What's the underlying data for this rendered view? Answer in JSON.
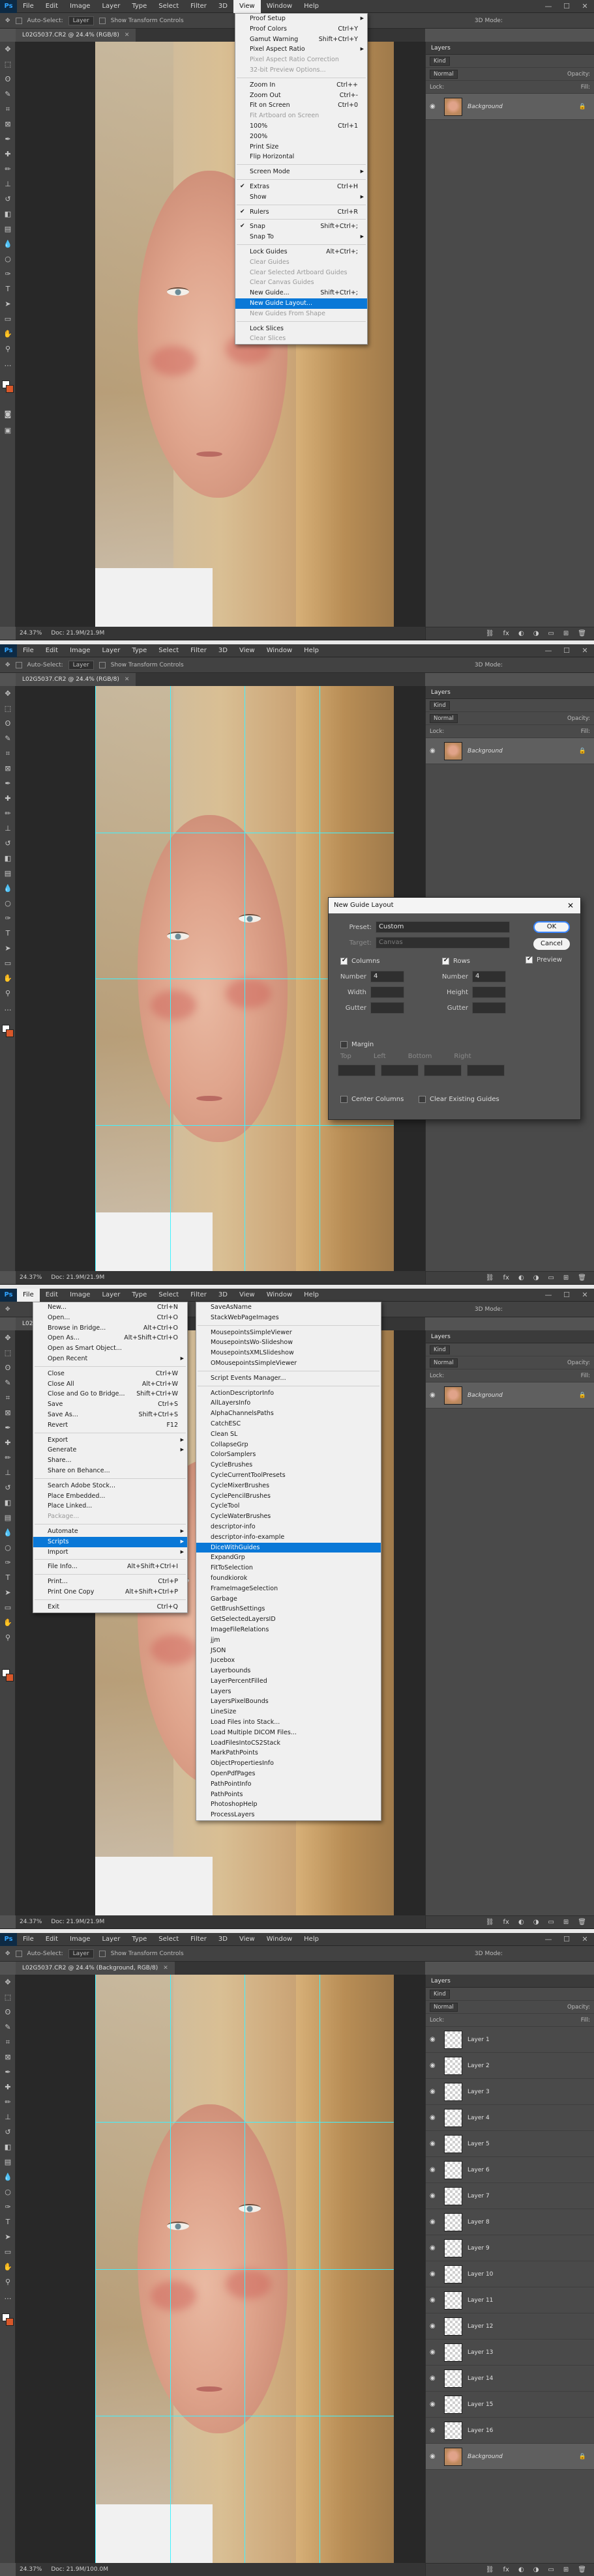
{
  "menubar": {
    "items": [
      "File",
      "Edit",
      "Image",
      "Layer",
      "Type",
      "Select",
      "Filter",
      "3D",
      "View",
      "Window",
      "Help"
    ],
    "logo": "Ps"
  },
  "options": {
    "auto_select": "Auto-Select:",
    "layer": "Layer",
    "show_transform": "Show Transform Controls",
    "mode_3d": "3D Mode:"
  },
  "document": {
    "tab_title_rgb": "L02G5037.CR2 @ 24.4% (RGB/8)",
    "tab_title_bg": "L02G5037.CR2 @ 24.4% (Background, RGB/8)",
    "zoom": "24.37%",
    "doc_size": "Doc: 21.9M/21.9M",
    "doc_size_4": "Doc: 21.9M/100.0M"
  },
  "layers": {
    "tab": "Layers",
    "kind": "Kind",
    "mode": "Normal",
    "opacity": "Opacity:",
    "lock": "Lock:",
    "fill": "Fill:",
    "background": "Background",
    "numbered": [
      "Layer 1",
      "Layer 2",
      "Layer 3",
      "Layer 4",
      "Layer 5",
      "Layer 6",
      "Layer 7",
      "Layer 8",
      "Layer 9",
      "Layer 10",
      "Layer 11",
      "Layer 12",
      "Layer 13",
      "Layer 14",
      "Layer 15",
      "Layer 16"
    ]
  },
  "view_menu": [
    {
      "label": "Proof Setup",
      "sub": true
    },
    {
      "label": "Proof Colors",
      "sc": "Ctrl+Y"
    },
    {
      "label": "Gamut Warning",
      "sc": "Shift+Ctrl+Y"
    },
    {
      "label": "Pixel Aspect Ratio",
      "sub": true
    },
    {
      "label": "Pixel Aspect Ratio Correction",
      "dis": true
    },
    {
      "label": "32-bit Preview Options...",
      "dis": true
    },
    {
      "sep": true
    },
    {
      "label": "Zoom In",
      "sc": "Ctrl++"
    },
    {
      "label": "Zoom Out",
      "sc": "Ctrl+-"
    },
    {
      "label": "Fit on Screen",
      "sc": "Ctrl+0"
    },
    {
      "label": "Fit Artboard on Screen",
      "dis": true
    },
    {
      "label": "100%",
      "sc": "Ctrl+1"
    },
    {
      "label": "200%"
    },
    {
      "label": "Print Size"
    },
    {
      "label": "Flip Horizontal"
    },
    {
      "sep": true
    },
    {
      "label": "Screen Mode",
      "sub": true
    },
    {
      "sep": true
    },
    {
      "label": "Extras",
      "sc": "Ctrl+H",
      "chk": true
    },
    {
      "label": "Show",
      "sub": true
    },
    {
      "sep": true
    },
    {
      "label": "Rulers",
      "sc": "Ctrl+R",
      "chk": true
    },
    {
      "sep": true
    },
    {
      "label": "Snap",
      "sc": "Shift+Ctrl+;",
      "chk": true
    },
    {
      "label": "Snap To",
      "sub": true
    },
    {
      "sep": true
    },
    {
      "label": "Lock Guides",
      "sc": "Alt+Ctrl+;"
    },
    {
      "label": "Clear Guides",
      "dis": true
    },
    {
      "label": "Clear Selected Artboard Guides",
      "dis": true
    },
    {
      "label": "Clear Canvas Guides",
      "dis": true
    },
    {
      "label": "New Guide...",
      "sc": "Shift+Ctrl+;"
    },
    {
      "label": "New Guide Layout...",
      "hl": true
    },
    {
      "label": "New Guides From Shape",
      "dis": true
    },
    {
      "sep": true
    },
    {
      "label": "Lock Slices"
    },
    {
      "label": "Clear Slices",
      "dis": true
    }
  ],
  "dialog": {
    "title": "New Guide Layout",
    "preset_label": "Preset:",
    "preset_value": "Custom",
    "target_label": "Target:",
    "target_value": "Canvas",
    "columns": "Columns",
    "rows": "Rows",
    "number": "Number",
    "number_cols": "4",
    "number_rows": "4",
    "width": "Width",
    "height": "Height",
    "gutter": "Gutter",
    "margin": "Margin",
    "top": "Top",
    "left": "Left",
    "bottom": "Bottom",
    "right": "Right",
    "center_columns": "Center Columns",
    "clear_existing": "Clear Existing Guides",
    "ok": "OK",
    "cancel": "Cancel",
    "preview": "Preview"
  },
  "file_menu": [
    {
      "label": "New...",
      "sc": "Ctrl+N"
    },
    {
      "label": "Open...",
      "sc": "Ctrl+O"
    },
    {
      "label": "Browse in Bridge...",
      "sc": "Alt+Ctrl+O"
    },
    {
      "label": "Open As...",
      "sc": "Alt+Shift+Ctrl+O"
    },
    {
      "label": "Open as Smart Object..."
    },
    {
      "label": "Open Recent",
      "sub": true
    },
    {
      "sep": true
    },
    {
      "label": "Close",
      "sc": "Ctrl+W"
    },
    {
      "label": "Close All",
      "sc": "Alt+Ctrl+W"
    },
    {
      "label": "Close and Go to Bridge...",
      "sc": "Shift+Ctrl+W"
    },
    {
      "label": "Save",
      "sc": "Ctrl+S"
    },
    {
      "label": "Save As...",
      "sc": "Shift+Ctrl+S"
    },
    {
      "label": "Revert",
      "sc": "F12"
    },
    {
      "sep": true
    },
    {
      "label": "Export",
      "sub": true
    },
    {
      "label": "Generate",
      "sub": true
    },
    {
      "label": "Share..."
    },
    {
      "label": "Share on Behance..."
    },
    {
      "sep": true
    },
    {
      "label": "Search Adobe Stock..."
    },
    {
      "label": "Place Embedded..."
    },
    {
      "label": "Place Linked..."
    },
    {
      "label": "Package...",
      "dis": true
    },
    {
      "sep": true
    },
    {
      "label": "Automate",
      "sub": true
    },
    {
      "label": "Scripts",
      "sub": true,
      "hl": true
    },
    {
      "label": "Import",
      "sub": true
    },
    {
      "sep": true
    },
    {
      "label": "File Info...",
      "sc": "Alt+Shift+Ctrl+I"
    },
    {
      "sep": true
    },
    {
      "label": "Print...",
      "sc": "Ctrl+P"
    },
    {
      "label": "Print One Copy",
      "sc": "Alt+Shift+Ctrl+P"
    },
    {
      "sep": true
    },
    {
      "label": "Exit",
      "sc": "Ctrl+Q"
    }
  ],
  "scripts_menu": [
    {
      "label": "SaveAsName"
    },
    {
      "label": "StackWebPageImages"
    },
    {
      "sep": true
    },
    {
      "label": "MousepointsSimpleViewer"
    },
    {
      "label": "MousepointsWo-Slideshow"
    },
    {
      "label": "MousepointsXMLSlideshow"
    },
    {
      "label": "OMousepointsSimpleViewer"
    },
    {
      "sep": true
    },
    {
      "label": "Script Events Manager..."
    },
    {
      "sep": true
    },
    {
      "label": "ActionDescriptorInfo"
    },
    {
      "label": "AllLayersInfo"
    },
    {
      "label": "AlphaChannelsPaths"
    },
    {
      "label": "CatchESC"
    },
    {
      "label": "Clean SL"
    },
    {
      "label": "CollapseGrp"
    },
    {
      "label": "ColorSamplers"
    },
    {
      "label": "CycleBrushes"
    },
    {
      "label": "CycleCurrentToolPresets"
    },
    {
      "label": "CycleMixerBrushes"
    },
    {
      "label": "CyclePencilBrushes"
    },
    {
      "label": "CycleTool"
    },
    {
      "label": "CycleWaterBrushes"
    },
    {
      "label": "descriptor-info"
    },
    {
      "label": "descriptor-info-example"
    },
    {
      "label": "DiceWithGuides",
      "hl": true
    },
    {
      "label": "ExpandGrp"
    },
    {
      "label": "FitToSelection"
    },
    {
      "label": "foundkiorok"
    },
    {
      "label": "FrameImageSelection"
    },
    {
      "label": "Garbage"
    },
    {
      "label": "GetBrushSettings"
    },
    {
      "label": "GetSelectedLayersID"
    },
    {
      "label": "ImageFileRelations"
    },
    {
      "label": "jjm"
    },
    {
      "label": "JSON"
    },
    {
      "label": "Jucebox"
    },
    {
      "label": "Layerbounds"
    },
    {
      "label": "LayerPercentFilled"
    },
    {
      "label": "Layers"
    },
    {
      "label": "LayersPixelBounds"
    },
    {
      "label": "LineSize"
    },
    {
      "label": "Load Files into Stack..."
    },
    {
      "label": "Load Multiple DICOM Files..."
    },
    {
      "label": "LoadFilesIntoCS2Stack"
    },
    {
      "label": "MarkPathPoints"
    },
    {
      "label": "ObjectPropertiesInfo"
    },
    {
      "label": "OpenPdfPages"
    },
    {
      "label": "PathPointInfo"
    },
    {
      "label": "PathPoints"
    },
    {
      "label": "PhotoshopHelp"
    },
    {
      "label": "ProcessLayers"
    }
  ]
}
